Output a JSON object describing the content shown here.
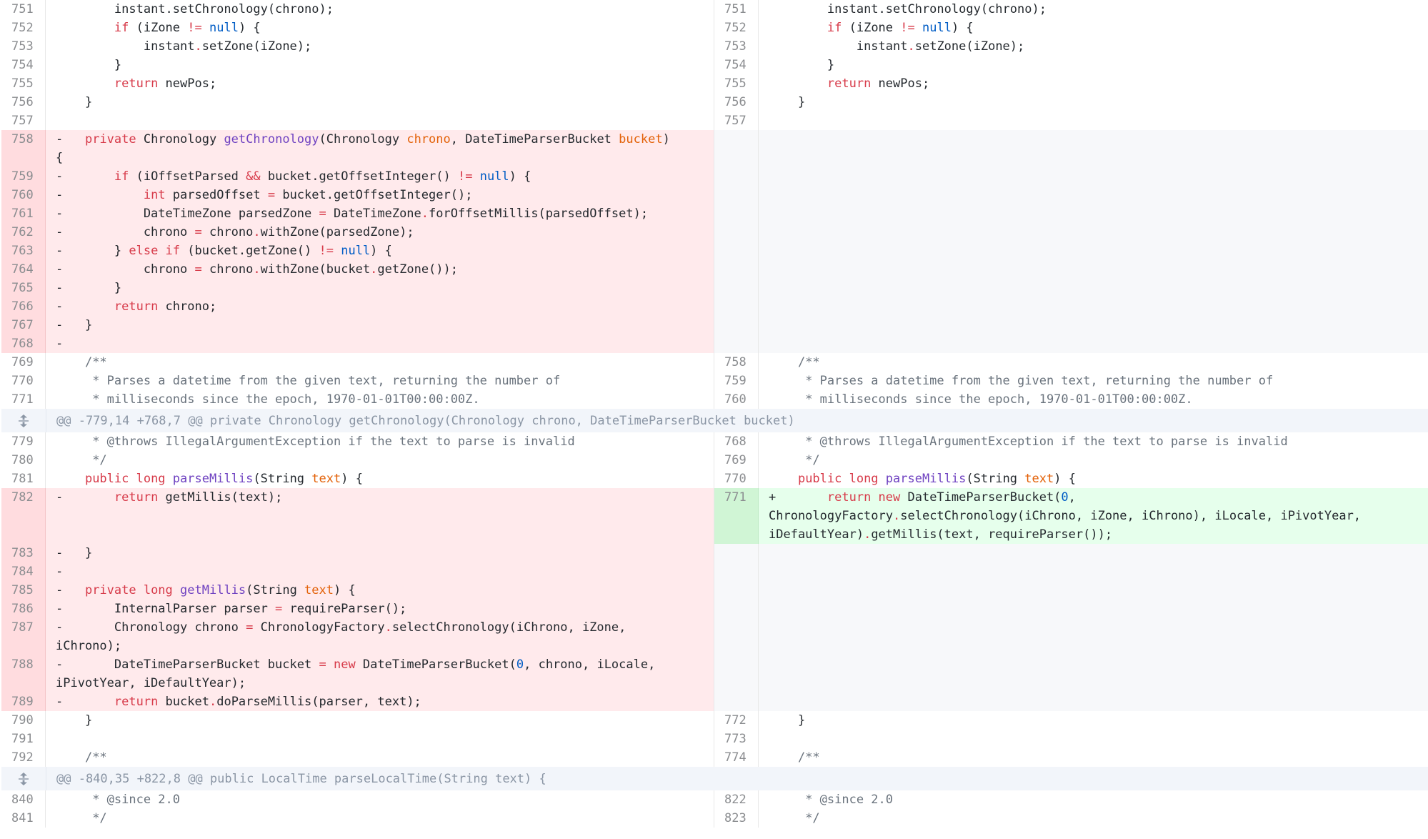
{
  "hunk_headers": [
    "@@ -779,14 +768,7 @@ private Chronology getChronology(Chronology chrono, DateTimeParserBucket bucket)",
    "@@ -840,35 +822,8 @@ public LocalTime parseLocalTime(String text) {"
  ],
  "icons": {
    "expand": "expand-arrows-icon"
  },
  "colors": {
    "deleted_bg": "#ffeaec",
    "added_bg": "#e6ffec",
    "hunk_bg": "#f2f5fa"
  },
  "rows": [
    {
      "type": "ctx",
      "l": "751",
      "r": "751",
      "lt": [
        [
          "        instant.setChronology(chrono);",
          ""
        ]
      ],
      "rt": [
        [
          "        instant.setChronology(chrono);",
          ""
        ]
      ]
    },
    {
      "type": "ctx",
      "l": "752",
      "r": "752",
      "lt": [
        [
          "        ",
          ""
        ],
        [
          "if",
          "k"
        ],
        [
          " (iZone ",
          ""
        ],
        [
          "!=",
          "k"
        ],
        [
          " ",
          ""
        ],
        [
          "null",
          "c"
        ],
        [
          ") {",
          ""
        ]
      ],
      "rt": [
        [
          "        ",
          ""
        ],
        [
          "if",
          "k"
        ],
        [
          " (iZone ",
          ""
        ],
        [
          "!=",
          "k"
        ],
        [
          " ",
          ""
        ],
        [
          "null",
          "c"
        ],
        [
          ") {",
          ""
        ]
      ]
    },
    {
      "type": "ctx",
      "l": "753",
      "r": "753",
      "lt": [
        [
          "            instant",
          ""
        ],
        [
          ".",
          "k"
        ],
        [
          "setZone(iZone);",
          ""
        ]
      ],
      "rt": [
        [
          "            instant",
          ""
        ],
        [
          ".",
          "k"
        ],
        [
          "setZone(iZone);",
          ""
        ]
      ]
    },
    {
      "type": "ctx",
      "l": "754",
      "r": "754",
      "lt": [
        [
          "        }",
          ""
        ]
      ],
      "rt": [
        [
          "        }",
          ""
        ]
      ]
    },
    {
      "type": "ctx",
      "l": "755",
      "r": "755",
      "lt": [
        [
          "        ",
          ""
        ],
        [
          "return",
          "k"
        ],
        [
          " newPos;",
          ""
        ]
      ],
      "rt": [
        [
          "        ",
          ""
        ],
        [
          "return",
          "k"
        ],
        [
          " newPos;",
          ""
        ]
      ]
    },
    {
      "type": "ctx",
      "l": "756",
      "r": "756",
      "lt": [
        [
          "    }",
          ""
        ]
      ],
      "rt": [
        [
          "    }",
          ""
        ]
      ]
    },
    {
      "type": "ctx",
      "l": "757",
      "r": "757",
      "lt": [
        [
          "",
          ""
        ]
      ],
      "rt": [
        [
          "",
          ""
        ]
      ]
    },
    {
      "type": "del",
      "l": "758",
      "lt": [
        [
          "-   ",
          ""
        ],
        [
          "private",
          "k"
        ],
        [
          " Chronology ",
          ""
        ],
        [
          "getChronology",
          "f"
        ],
        [
          "(Chronology ",
          ""
        ],
        [
          "chrono",
          "p"
        ],
        [
          ", DateTimeParserBucket ",
          ""
        ],
        [
          "bucket",
          "p"
        ],
        [
          ")\n{",
          ""
        ]
      ]
    },
    {
      "type": "del",
      "l": "759",
      "lt": [
        [
          "-       ",
          ""
        ],
        [
          "if",
          "k"
        ],
        [
          " (iOffsetParsed ",
          ""
        ],
        [
          "&&",
          "k"
        ],
        [
          " bucket.getOffsetInteger() ",
          ""
        ],
        [
          "!=",
          "k"
        ],
        [
          " ",
          ""
        ],
        [
          "null",
          "c"
        ],
        [
          ") {",
          ""
        ]
      ]
    },
    {
      "type": "del",
      "l": "760",
      "lt": [
        [
          "-           ",
          ""
        ],
        [
          "int",
          "k"
        ],
        [
          " parsedOffset ",
          ""
        ],
        [
          "=",
          "k"
        ],
        [
          " bucket.getOffsetInteger();",
          ""
        ]
      ]
    },
    {
      "type": "del",
      "l": "761",
      "lt": [
        [
          "-           DateTimeZone parsedZone ",
          ""
        ],
        [
          "=",
          "k"
        ],
        [
          " DateTimeZone",
          ""
        ],
        [
          ".",
          "k"
        ],
        [
          "forOffsetMillis(parsedOffset);",
          ""
        ]
      ]
    },
    {
      "type": "del",
      "l": "762",
      "lt": [
        [
          "-           chrono ",
          ""
        ],
        [
          "=",
          "k"
        ],
        [
          " chrono",
          ""
        ],
        [
          ".",
          "k"
        ],
        [
          "withZone(parsedZone);",
          ""
        ]
      ]
    },
    {
      "type": "del",
      "l": "763",
      "lt": [
        [
          "-       } ",
          ""
        ],
        [
          "else if",
          "k"
        ],
        [
          " (bucket.getZone() ",
          ""
        ],
        [
          "!=",
          "k"
        ],
        [
          " ",
          ""
        ],
        [
          "null",
          "c"
        ],
        [
          ") {",
          ""
        ]
      ]
    },
    {
      "type": "del",
      "l": "764",
      "lt": [
        [
          "-           chrono ",
          ""
        ],
        [
          "=",
          "k"
        ],
        [
          " chrono",
          ""
        ],
        [
          ".",
          "k"
        ],
        [
          "withZone(bucket",
          ""
        ],
        [
          ".",
          "k"
        ],
        [
          "getZone());",
          ""
        ]
      ]
    },
    {
      "type": "del",
      "l": "765",
      "lt": [
        [
          "-       }",
          ""
        ]
      ]
    },
    {
      "type": "del",
      "l": "766",
      "lt": [
        [
          "-       ",
          ""
        ],
        [
          "return",
          "k"
        ],
        [
          " chrono;",
          ""
        ]
      ]
    },
    {
      "type": "del",
      "l": "767",
      "lt": [
        [
          "-   }",
          ""
        ]
      ]
    },
    {
      "type": "del",
      "l": "768",
      "lt": [
        [
          "-",
          ""
        ]
      ]
    },
    {
      "type": "ctx",
      "l": "769",
      "r": "758",
      "lt": [
        [
          "    /**",
          "cm"
        ]
      ],
      "rt": [
        [
          "    /**",
          "cm"
        ]
      ]
    },
    {
      "type": "ctx",
      "l": "770",
      "r": "759",
      "lt": [
        [
          "     * Parses a datetime from the given text, returning the number of",
          "cm"
        ]
      ],
      "rt": [
        [
          "     * Parses a datetime from the given text, returning the number of",
          "cm"
        ]
      ]
    },
    {
      "type": "ctx",
      "l": "771",
      "r": "760",
      "lt": [
        [
          "     * milliseconds since the epoch, 1970-01-01T00:00:00Z.",
          "cm"
        ]
      ],
      "rt": [
        [
          "     * milliseconds since the epoch, 1970-01-01T00:00:00Z.",
          "cm"
        ]
      ]
    },
    {
      "type": "hunk",
      "h": 0
    },
    {
      "type": "ctx",
      "l": "779",
      "r": "768",
      "lt": [
        [
          "     * @throws IllegalArgumentException if the text to parse is invalid",
          "cm"
        ]
      ],
      "rt": [
        [
          "     * @throws IllegalArgumentException if the text to parse is invalid",
          "cm"
        ]
      ]
    },
    {
      "type": "ctx",
      "l": "780",
      "r": "769",
      "lt": [
        [
          "     */",
          "cm"
        ]
      ],
      "rt": [
        [
          "     */",
          "cm"
        ]
      ]
    },
    {
      "type": "ctx",
      "l": "781",
      "r": "770",
      "lt": [
        [
          "    ",
          ""
        ],
        [
          "public long",
          "k"
        ],
        [
          " ",
          ""
        ],
        [
          "parseMillis",
          "f"
        ],
        [
          "(String ",
          ""
        ],
        [
          "text",
          "p"
        ],
        [
          ") {",
          ""
        ]
      ],
      "rt": [
        [
          "    ",
          ""
        ],
        [
          "public long",
          "k"
        ],
        [
          " ",
          ""
        ],
        [
          "parseMillis",
          "f"
        ],
        [
          "(String ",
          ""
        ],
        [
          "text",
          "p"
        ],
        [
          ") {",
          ""
        ]
      ]
    },
    {
      "type": "mix",
      "l": "782",
      "r": "771",
      "lt": [
        [
          "-       ",
          ""
        ],
        [
          "return",
          "k"
        ],
        [
          " getMillis(text);",
          ""
        ]
      ],
      "rt": [
        [
          "+       ",
          ""
        ],
        [
          "return new",
          "k"
        ],
        [
          " DateTimeParserBucket(",
          ""
        ],
        [
          "0",
          "c"
        ],
        [
          ",\nChronologyFactory",
          ""
        ],
        [
          ".",
          "k"
        ],
        [
          "selectChronology(iChrono, iZone, iChrono), iLocale, iPivotYear,\niDefaultYear)",
          ""
        ],
        [
          ".",
          "k"
        ],
        [
          "getMillis(text, requireParser());",
          ""
        ]
      ]
    },
    {
      "type": "del",
      "l": "783",
      "lt": [
        [
          "-   }",
          ""
        ]
      ]
    },
    {
      "type": "del",
      "l": "784",
      "lt": [
        [
          "-",
          ""
        ]
      ]
    },
    {
      "type": "del",
      "l": "785",
      "lt": [
        [
          "-   ",
          ""
        ],
        [
          "private long",
          "k"
        ],
        [
          " ",
          ""
        ],
        [
          "getMillis",
          "f"
        ],
        [
          "(String ",
          ""
        ],
        [
          "text",
          "p"
        ],
        [
          ") {",
          ""
        ]
      ]
    },
    {
      "type": "del",
      "l": "786",
      "lt": [
        [
          "-       InternalParser parser ",
          ""
        ],
        [
          "=",
          "k"
        ],
        [
          " requireParser();",
          ""
        ]
      ]
    },
    {
      "type": "del",
      "l": "787",
      "lt": [
        [
          "-       Chronology chrono ",
          ""
        ],
        [
          "=",
          "k"
        ],
        [
          " ChronologyFactory",
          ""
        ],
        [
          ".",
          "k"
        ],
        [
          "selectChronology(iChrono, iZone,\niChrono);",
          ""
        ]
      ]
    },
    {
      "type": "del",
      "l": "788",
      "lt": [
        [
          "-       DateTimeParserBucket bucket ",
          ""
        ],
        [
          "=",
          "k"
        ],
        [
          " ",
          ""
        ],
        [
          "new",
          "k"
        ],
        [
          " DateTimeParserBucket(",
          ""
        ],
        [
          "0",
          "c"
        ],
        [
          ", chrono, iLocale,\niPivotYear, iDefaultYear);",
          ""
        ]
      ]
    },
    {
      "type": "del",
      "l": "789",
      "lt": [
        [
          "-       ",
          ""
        ],
        [
          "return",
          "k"
        ],
        [
          " bucket",
          ""
        ],
        [
          ".",
          "k"
        ],
        [
          "doParseMillis(parser, text);",
          ""
        ]
      ]
    },
    {
      "type": "ctx",
      "l": "790",
      "r": "772",
      "lt": [
        [
          "    }",
          ""
        ]
      ],
      "rt": [
        [
          "    }",
          ""
        ]
      ]
    },
    {
      "type": "ctx",
      "l": "791",
      "r": "773",
      "lt": [
        [
          "",
          ""
        ]
      ],
      "rt": [
        [
          "",
          ""
        ]
      ]
    },
    {
      "type": "ctx",
      "l": "792",
      "r": "774",
      "lt": [
        [
          "    /**",
          "cm"
        ]
      ],
      "rt": [
        [
          "    /**",
          "cm"
        ]
      ]
    },
    {
      "type": "hunk",
      "h": 1
    },
    {
      "type": "ctx",
      "l": "840",
      "r": "822",
      "lt": [
        [
          "     * @since 2.0",
          "cm"
        ]
      ],
      "rt": [
        [
          "     * @since 2.0",
          "cm"
        ]
      ]
    },
    {
      "type": "ctx",
      "l": "841",
      "r": "823",
      "lt": [
        [
          "     */",
          "cm"
        ]
      ],
      "rt": [
        [
          "     */",
          "cm"
        ]
      ]
    }
  ]
}
